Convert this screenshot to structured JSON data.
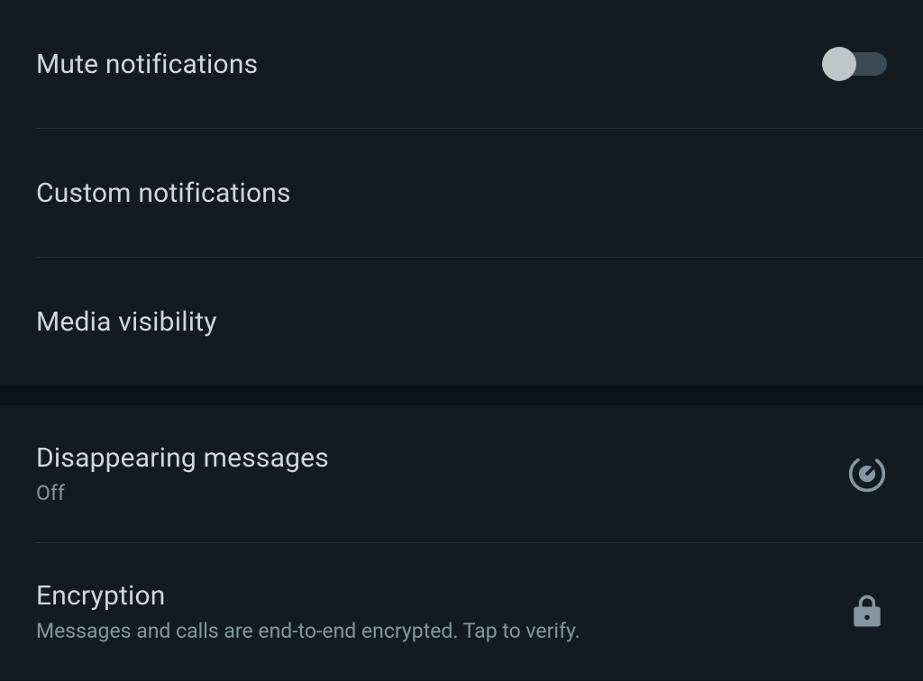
{
  "group1": {
    "items": [
      {
        "label": "Mute notifications"
      },
      {
        "label": "Custom notifications"
      },
      {
        "label": "Media visibility"
      }
    ]
  },
  "group2": {
    "disappearing": {
      "label": "Disappearing messages",
      "value": "Off"
    },
    "encryption": {
      "label": "Encryption",
      "description": "Messages and calls are end-to-end encrypted. Tap to verify."
    }
  },
  "mute_switch_on": false
}
